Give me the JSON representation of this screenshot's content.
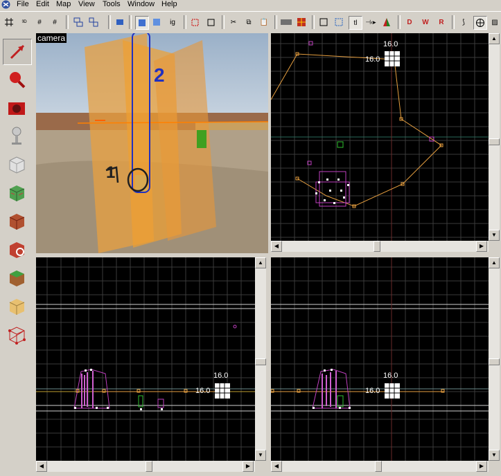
{
  "menu": [
    "File",
    "Edit",
    "Map",
    "View",
    "Tools",
    "Window",
    "Help"
  ],
  "toolbar": {
    "ig_label": "ig",
    "tl_label": "tl"
  },
  "camera_view": {
    "label": "camera",
    "annotation_1": "1",
    "annotation_2": "2"
  },
  "grid_views": {
    "grid_size_top": "16.0",
    "grid_size_left": "16.0"
  },
  "colors": {
    "accent_orange": "#e8a040",
    "selection_magenta": "#c040c0",
    "grid_line": "#3a3a3a",
    "annotation_blue": "#2030c0"
  }
}
